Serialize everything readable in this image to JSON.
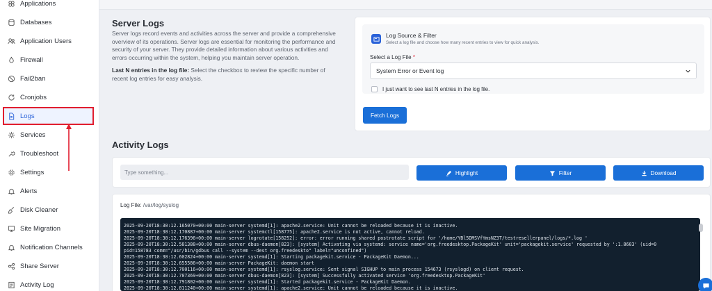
{
  "sidebar": {
    "items": [
      {
        "label": "Applications",
        "icon": "applications-icon"
      },
      {
        "label": "Databases",
        "icon": "database-icon"
      },
      {
        "label": "Application Users",
        "icon": "users-icon"
      },
      {
        "label": "Firewall",
        "icon": "firewall-icon"
      },
      {
        "label": "Fail2ban",
        "icon": "ban-icon"
      },
      {
        "label": "Cronjobs",
        "icon": "refresh-icon"
      },
      {
        "label": "Logs",
        "icon": "document-icon",
        "active": true
      },
      {
        "label": "Services",
        "icon": "services-icon"
      },
      {
        "label": "Troubleshoot",
        "icon": "troubleshoot-icon"
      },
      {
        "label": "Settings",
        "icon": "gear-icon"
      },
      {
        "label": "Alerts",
        "icon": "bell-icon"
      },
      {
        "label": "Disk Cleaner",
        "icon": "broom-icon"
      },
      {
        "label": "Site Migration",
        "icon": "migration-icon"
      },
      {
        "label": "Notification Channels",
        "icon": "bell-icon"
      },
      {
        "label": "Share Server",
        "icon": "share-icon"
      },
      {
        "label": "Activity Log",
        "icon": "activity-icon"
      }
    ]
  },
  "server_logs": {
    "title": "Server Logs",
    "description": "Server logs record events and activities across the server and provide a comprehensive overview of its operations. Server logs are essential for monitoring the performance and security of your server. They provide detailed information about various activities and errors occurring within the system, helping you maintain server operation.",
    "last_n_title": "Last N entries in the log file:",
    "last_n_desc": "Select the checkbox to review the specific number of recent log entries for easy analysis."
  },
  "log_source": {
    "title": "Log Source & Filter",
    "subtitle": "Select a log file and choose how many recent entries to view for quick analysis.",
    "select_label": "Select a Log File",
    "required_mark": "*",
    "selected_value": "System Error or Event log",
    "checkbox_label": "I just want to see last N entries in the log file.",
    "fetch_button": "Fetch Logs"
  },
  "activity_logs": {
    "title": "Activity Logs",
    "search_placeholder": "Type something...",
    "highlight_button": "Highlight",
    "filter_button": "Filter",
    "download_button": "Download",
    "log_file_label": "Log File:",
    "log_file_path": "/var/log/syslog",
    "lines": [
      "2025-09-20T18:30:12.165070+00:00 main-server systemd[1]: apache2.service: Unit cannot be reloaded because it is inactive.",
      "2025-09-20T18:30:12.170887+00:00 main-server systemctl[158775]: apache2.service is not active, cannot reload.",
      "2025-09-20T18:30:12.176396+00:00 main-server logrotate[158252]: error: error running shared postrotate script for '/home/YBl5DMSVfYmsNZ3T/testresellerpanel/logs/*.log '",
      "2025-09-20T18:30:12.581388+00:00 main-server dbus-daemon[823]: [system] Activating via systemd: service name='org.freedesktop.PackageKit' unit='packagekit.service' requested by ':1.8603' (uid=0",
      "pid=158783 comm=\"/usr/bin/gdbus call --system --dest org.freedeskto\" label=\"unconfined\")",
      "2025-09-20T18:30:12.602824+00:00 main-server systemd[1]: Starting packagekit.service - PackageKit Daemon...",
      "2025-09-20T18:30:12.655586+00:00 main-server PackageKit: daemon start",
      "2025-09-20T18:30:12.700116+00:00 main-server systemd[1]: rsyslog.service: Sent signal SIGHUP to main process 154673 (rsyslogd) on client request.",
      "2025-09-20T18:30:12.787369+00:00 main-server dbus-daemon[823]: [system] Successfully activated service 'org.freedesktop.PackageKit'",
      "2025-09-20T18:30:12.791802+00:00 main-server systemd[1]: Started packagekit.service - PackageKit Daemon.",
      "2025-09-20T18:30:12.811240+00:00 main-server systemd[1]: apache2.service: Unit cannot be reloaded because it is inactive."
    ]
  },
  "colors": {
    "accent": "#1a6fd8",
    "annotation_red": "#e11d2e",
    "terminal_bg": "#12202e"
  }
}
